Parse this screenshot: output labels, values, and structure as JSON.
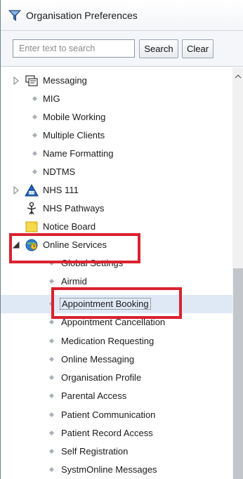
{
  "window": {
    "title": "Organisation Preferences",
    "title_icon": "filter-funnel-icon"
  },
  "search": {
    "placeholder": "Enter text to search",
    "value": "",
    "search_label": "Search",
    "clear_label": "Clear"
  },
  "tree": {
    "items": [
      {
        "label": "Messaging",
        "type": "folder",
        "expander": "collapsed",
        "icon": "messaging-icon"
      },
      {
        "label": "MIG",
        "type": "leaf"
      },
      {
        "label": "Mobile Working",
        "type": "leaf"
      },
      {
        "label": "Multiple Clients",
        "type": "leaf"
      },
      {
        "label": "Name Formatting",
        "type": "leaf"
      },
      {
        "label": "NDTMS",
        "type": "leaf"
      },
      {
        "label": "NHS 111",
        "type": "folder",
        "expander": "collapsed",
        "icon": "nhs111-icon"
      },
      {
        "label": "NHS Pathways",
        "type": "folder",
        "icon": "nhs-pathways-icon"
      },
      {
        "label": "Notice Board",
        "type": "folder",
        "icon": "notice-board-icon"
      },
      {
        "label": "Online Services",
        "type": "folder",
        "expander": "expanded",
        "icon": "online-services-icon"
      },
      {
        "label": "Global Settings",
        "type": "child"
      },
      {
        "label": "Airmid",
        "type": "child"
      },
      {
        "label": "Appointment Booking",
        "type": "child",
        "selected": true
      },
      {
        "label": "Appointment Cancellation",
        "type": "child"
      },
      {
        "label": "Medication Requesting",
        "type": "child"
      },
      {
        "label": "Online Messaging",
        "type": "child"
      },
      {
        "label": "Organisation Profile",
        "type": "child"
      },
      {
        "label": "Parental Access",
        "type": "child"
      },
      {
        "label": "Patient Communication",
        "type": "child"
      },
      {
        "label": "Patient Record Access",
        "type": "child"
      },
      {
        "label": "Self Registration",
        "type": "child"
      },
      {
        "label": "SystmOnline Messages",
        "type": "child"
      }
    ]
  },
  "colors": {
    "highlight_border": "#d9222f",
    "selection_bg": "#dfe9f6"
  }
}
